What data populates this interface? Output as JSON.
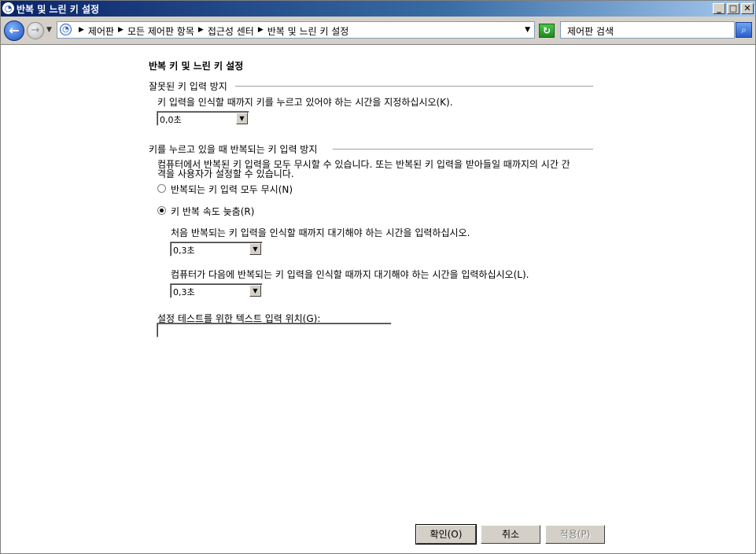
{
  "window": {
    "title": "반복 및 느린 키 설정",
    "controls": {
      "minimize": "_",
      "maximize": "□",
      "close": "✕"
    }
  },
  "nav": {
    "breadcrumbs": [
      "제어판",
      "모든 제어판 항목",
      "접근성 센터",
      "반복 및 느린 키 설정"
    ],
    "search_placeholder": "제어판 검색"
  },
  "page": {
    "title": "반복 키 및 느린 키 설정",
    "slow_keys": {
      "group_title": "잘못된 키 입력 방지",
      "description": "키 입력을 인식할 때까지 키를 누르고 있어야 하는 시간을 지정하십시오(K).",
      "value": "0,0초"
    },
    "repeat_keys": {
      "group_title": "키를 누르고 있을 때 반복되는 키 입력 방지",
      "description_line1": "컴퓨터에서 반복된 키 입력을 모두 무시할 수 있습니다. 또는 반복된 키 입력을 받아들일 때까지의 시간 간",
      "description_line2": "격을 사용자가 설정할 수 있습니다.",
      "option_ignore": "반복되는 키 입력 모두 무시(N)",
      "option_slow": "키 반복 속도 늦춤(R)",
      "selected_option": "option_slow",
      "first_delay_label": "처음 반복되는 키 입력을 인식할 때까지 대기해야 하는 시간을 입력하십시오.",
      "first_delay_value": "0,3초",
      "next_delay_label": "컴퓨터가 다음에 반복되는 키 입력을 인식할 때까지 대기해야 하는 시간을 입력하십시오(L).",
      "next_delay_value": "0,3초"
    },
    "test": {
      "label": "설정 테스트를 위한 텍스트 입력 위치(G):",
      "value": ""
    }
  },
  "buttons": {
    "ok": "확인(O)",
    "cancel": "취소",
    "apply": "적용(P)"
  }
}
